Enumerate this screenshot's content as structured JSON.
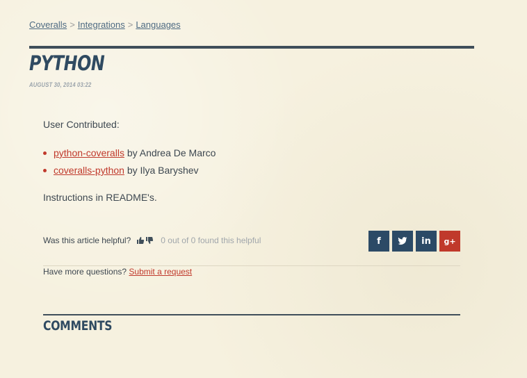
{
  "breadcrumb": {
    "items": [
      "Coveralls",
      "Integrations",
      "Languages"
    ],
    "separator": ">"
  },
  "article": {
    "title": "PYTHON",
    "date": "AUGUST 30, 2014 03:22",
    "intro": "User Contributed:",
    "contributions": [
      {
        "link": "python-coveralls",
        "author_text": "by Andrea De Marco"
      },
      {
        "link": "coveralls-python",
        "author_text": "by Ilya Baryshev"
      }
    ],
    "instructions": "Instructions in README's."
  },
  "vote": {
    "question": "Was this article helpful?",
    "count_text": "0 out of 0 found this helpful",
    "icons": [
      "thumbs-up-icon",
      "thumbs-down-icon"
    ]
  },
  "share": {
    "buttons": [
      {
        "name": "facebook",
        "glyph": "f"
      },
      {
        "name": "twitter",
        "glyph": "t"
      },
      {
        "name": "linkedin",
        "glyph": "in"
      },
      {
        "name": "google-plus",
        "glyph": "g+"
      }
    ],
    "colors": {
      "dark": "#2c4a66",
      "accent": "#c0392b"
    }
  },
  "help": {
    "text": "Have more questions?",
    "link": "Submit a request"
  },
  "comments": {
    "heading": "COMMENTS"
  },
  "theme": {
    "background": "#f6f1df",
    "heading": "#2f4a61",
    "link": "#c0392b"
  }
}
